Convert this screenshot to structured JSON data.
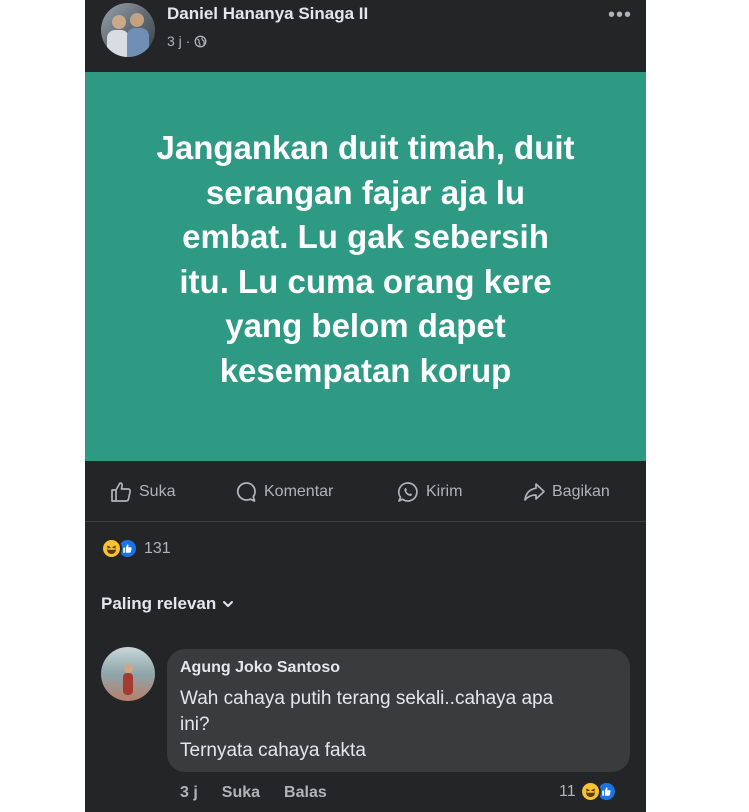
{
  "post": {
    "author": "Daniel Hananya Sinaga II",
    "time": "3 j ·",
    "menu_label": "•••",
    "background_color": "#2e9a84",
    "text_lines": [
      "Jangankan duit timah, duit",
      "serangan fajar aja lu",
      "embat. Lu gak sebersih",
      "itu. Lu cuma orang kere",
      "yang belom dapet",
      "kesempatan korup"
    ],
    "privacy_icon": "globe-icon"
  },
  "actions": {
    "like": "Suka",
    "comment": "Komentar",
    "send": "Kirim",
    "share": "Bagikan"
  },
  "reactions": {
    "icons": [
      "haha-emoji-icon",
      "like-emoji-icon"
    ],
    "count": "131"
  },
  "comments_sort": {
    "label": "Paling relevan",
    "icon": "chevron-down-icon"
  },
  "comment": {
    "author": "Agung Joko Santoso",
    "lines": [
      "Wah cahaya putih terang sekali..cahaya apa",
      "ini?",
      "Ternyata cahaya fakta"
    ],
    "time": "3 j",
    "like_label": "Suka",
    "reply_label": "Balas",
    "reaction_count": "11"
  },
  "colors": {
    "panel": "#242526",
    "bubble": "#3a3b3c",
    "text_primary": "#e4e6eb",
    "text_secondary": "#b0b3b8",
    "like_blue": "#1b74e4",
    "haha_yellow": "#f7c134"
  }
}
